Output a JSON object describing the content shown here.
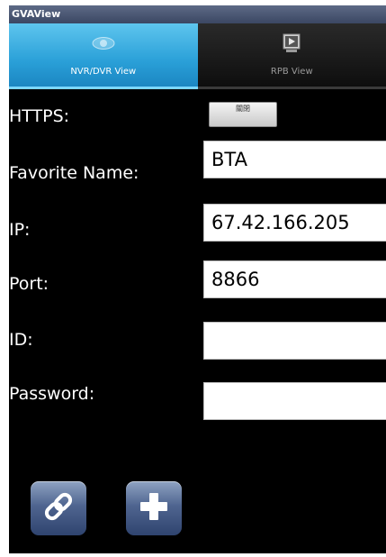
{
  "window": {
    "title": "GVAView"
  },
  "tabs": [
    {
      "label": "NVR/DVR View",
      "icon": "eye-icon",
      "active": true
    },
    {
      "label": "RPB View",
      "icon": "playback-icon",
      "active": false
    }
  ],
  "form": {
    "https": {
      "label": "HTTPS:",
      "toggle_text": "關閉"
    },
    "favorite_name": {
      "label": "Favorite Name:",
      "value": "BTA"
    },
    "ip": {
      "label": "IP:",
      "value": "67.42.166.205"
    },
    "port": {
      "label": "Port:",
      "value": "8866"
    },
    "id": {
      "label": "ID:",
      "value": ""
    },
    "password": {
      "label": "Password:",
      "value": ""
    }
  },
  "buttons": [
    {
      "icon": "link-icon"
    },
    {
      "icon": "plus-icon"
    }
  ],
  "colors": {
    "background": "#000000",
    "tab_active": "#2aa0d8",
    "button": "#4f6590"
  }
}
